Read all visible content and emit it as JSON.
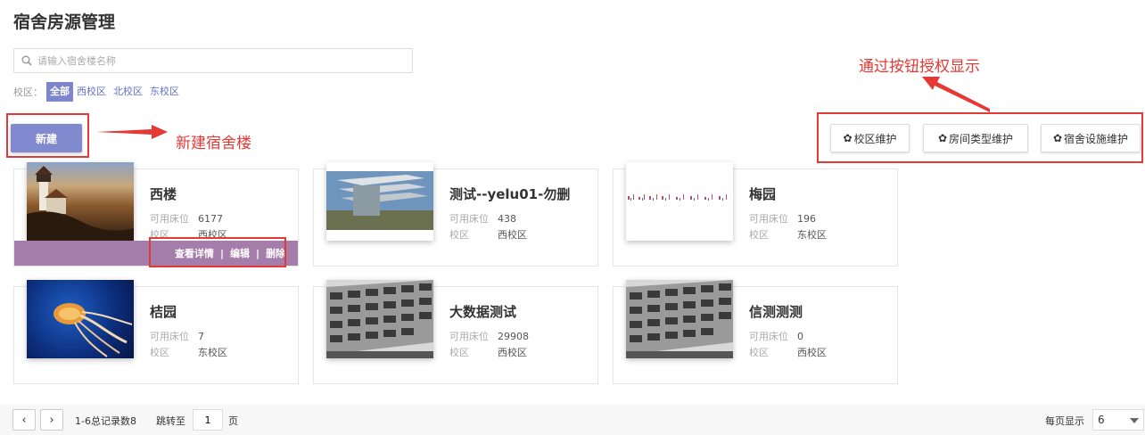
{
  "page": {
    "title": "宿舍房源管理"
  },
  "search": {
    "placeholder": "请输入宿舍楼名称"
  },
  "campus_filter": {
    "label": "校区：",
    "options": [
      "全部",
      "西校区",
      "北校区",
      "东校区"
    ],
    "selected": "全部"
  },
  "toolbar": {
    "new_label": "新建",
    "campus_maint_label": "校区维护",
    "room_type_maint_label": "房间类型维护",
    "facility_maint_label": "宿舍设施维护"
  },
  "annotations": {
    "new_building": "新建宿舍楼",
    "button_auth": "通过按钮授权显示"
  },
  "labels": {
    "beds": "可用床位",
    "campus": "校区"
  },
  "buildings": [
    {
      "name": "西楼",
      "beds": "6177",
      "campus": "西校区"
    },
    {
      "name": "测试--yelu01-勿删",
      "beds": "438",
      "campus": "西校区"
    },
    {
      "name": "梅园",
      "beds": "196",
      "campus": "东校区"
    },
    {
      "name": "桔园",
      "beds": "7",
      "campus": "东校区"
    },
    {
      "name": "大数据测试",
      "beds": "29908",
      "campus": "西校区"
    },
    {
      "name": "信测测测",
      "beds": "0",
      "campus": "西校区"
    }
  ],
  "card_actions": {
    "view": "查看详情",
    "edit": "编辑",
    "delete": "删除",
    "separator": "|"
  },
  "pager": {
    "prev": "‹",
    "next": "›",
    "summary": "1-6总记录数8",
    "jump_label": "跳转至",
    "jump_value": "1",
    "page_unit": "页",
    "per_page_label": "每页显示",
    "per_page_value": "6"
  },
  "colors": {
    "accent": "#8189cf",
    "annotation": "#e53935",
    "action_bar": "#a47dab",
    "link": "#6173c7"
  }
}
